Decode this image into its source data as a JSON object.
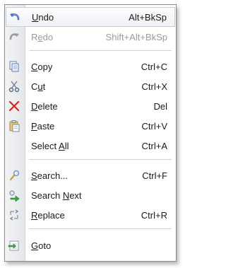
{
  "menu": {
    "items": [
      {
        "id": "undo",
        "pre": "",
        "u": "U",
        "post": "ndo",
        "shortcut": "Alt+BkSp",
        "icon": "undo-icon",
        "enabled": true
      },
      {
        "id": "redo",
        "pre": "R",
        "u": "e",
        "post": "do",
        "shortcut": "Shift+Alt+BkSp",
        "icon": "redo-icon",
        "enabled": false
      },
      {
        "id": "copy",
        "pre": "",
        "u": "C",
        "post": "opy",
        "shortcut": "Ctrl+C",
        "icon": "copy-icon",
        "enabled": true
      },
      {
        "id": "cut",
        "pre": "C",
        "u": "u",
        "post": "t",
        "shortcut": "Ctrl+X",
        "icon": "scissors-icon",
        "enabled": true
      },
      {
        "id": "delete",
        "pre": "",
        "u": "D",
        "post": "elete",
        "shortcut": "Del",
        "icon": "delete-x-icon",
        "enabled": true
      },
      {
        "id": "paste",
        "pre": "",
        "u": "P",
        "post": "aste",
        "shortcut": "Ctrl+V",
        "icon": "paste-icon",
        "enabled": true
      },
      {
        "id": "select-all",
        "pre": "Select ",
        "u": "A",
        "post": "ll",
        "shortcut": "Ctrl+A",
        "icon": "",
        "enabled": true
      },
      {
        "id": "search",
        "pre": "",
        "u": "S",
        "post": "earch...",
        "shortcut": "Ctrl+F",
        "icon": "search-icon",
        "enabled": true
      },
      {
        "id": "search-next",
        "pre": "Search ",
        "u": "N",
        "post": "ext",
        "shortcut": "",
        "icon": "search-next-icon",
        "enabled": true
      },
      {
        "id": "replace",
        "pre": "",
        "u": "R",
        "post": "eplace",
        "shortcut": "Ctrl+R",
        "icon": "replace-icon",
        "enabled": true
      },
      {
        "id": "goto",
        "pre": "",
        "u": "G",
        "post": "oto",
        "shortcut": "",
        "icon": "goto-icon",
        "enabled": true
      }
    ]
  },
  "colors": {
    "highlight_border": "#c8cfdc",
    "disabled_text": "#9b9b9b",
    "delete_red": "#e02020"
  }
}
